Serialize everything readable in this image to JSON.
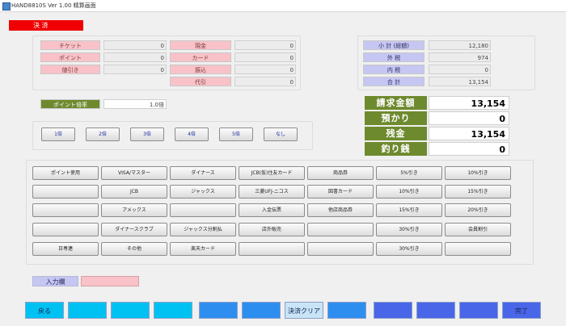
{
  "window": {
    "title": "HAND8810S Ver 1.00 精算画面"
  },
  "header": {
    "red_label": "決 済"
  },
  "left_panel": {
    "rows_a": [
      {
        "label": "チケット",
        "value": "0"
      },
      {
        "label": "ポイント",
        "value": "0"
      },
      {
        "label": "値引き",
        "value": "0"
      }
    ],
    "rows_b": [
      {
        "label": "現金",
        "value": "0"
      },
      {
        "label": "カード",
        "value": "0"
      },
      {
        "label": "振込",
        "value": "0"
      },
      {
        "label": "代引",
        "value": "0"
      }
    ]
  },
  "right_panel": {
    "rows": [
      {
        "label": "小 計 (総額)",
        "value": "12,180"
      },
      {
        "label": "外 税",
        "value": "974"
      },
      {
        "label": "内 税",
        "value": "0"
      },
      {
        "label": "合 計",
        "value": "13,154"
      }
    ]
  },
  "point_rate": {
    "label": "ポイント倍率",
    "value": "1.0倍"
  },
  "totals": [
    {
      "label": "請求金額",
      "value": "13,154"
    },
    {
      "label": "預かり",
      "value": "0"
    },
    {
      "label": "残金",
      "value": "13,154"
    },
    {
      "label": "釣り銭",
      "value": "0"
    }
  ],
  "rate_buttons": [
    "1倍",
    "2倍",
    "3倍",
    "4倍",
    "5倍",
    "なし"
  ],
  "payment_grid": [
    [
      "ポイント使用",
      "VISA/マスター",
      "ダイナース",
      "JCB(仮)住友カード",
      "商品券",
      "5%引き",
      "10%引き"
    ],
    [
      "",
      "JCB",
      "ジャックス",
      "三菱UFJ-ニコス",
      "図書カード",
      "10%引き",
      "15%引き"
    ],
    [
      "",
      "アメックス",
      "",
      "入金伝票",
      "他店商品券",
      "15%引き",
      "20%引き"
    ],
    [
      "",
      "ダイナースクラブ",
      "ジャックス分割払",
      "店外販売",
      "",
      "30%引き",
      "会員割引"
    ],
    [
      "日専連",
      "その他",
      "楽天カード",
      "",
      "",
      "30%引き",
      ""
    ]
  ],
  "input_label": "入力欄",
  "bottom_buttons": [
    {
      "label": "戻る",
      "color": "#00c2f2"
    },
    {
      "label": "",
      "color": "#00c2f2"
    },
    {
      "label": "",
      "color": "#00c2f2"
    },
    {
      "label": "",
      "color": "#00c2f2"
    },
    {
      "label": "",
      "color": "#2e8ef0"
    },
    {
      "label": "",
      "color": "#2e8ef0"
    },
    {
      "label": "決済クリア",
      "color": "#c8e4f6"
    },
    {
      "label": "",
      "color": "#2e8ef0"
    },
    {
      "label": "",
      "color": "#4a66e8"
    },
    {
      "label": "",
      "color": "#4a66e8"
    },
    {
      "label": "",
      "color": "#4a66e8"
    },
    {
      "label": "完了",
      "color": "#4a66e8"
    }
  ]
}
